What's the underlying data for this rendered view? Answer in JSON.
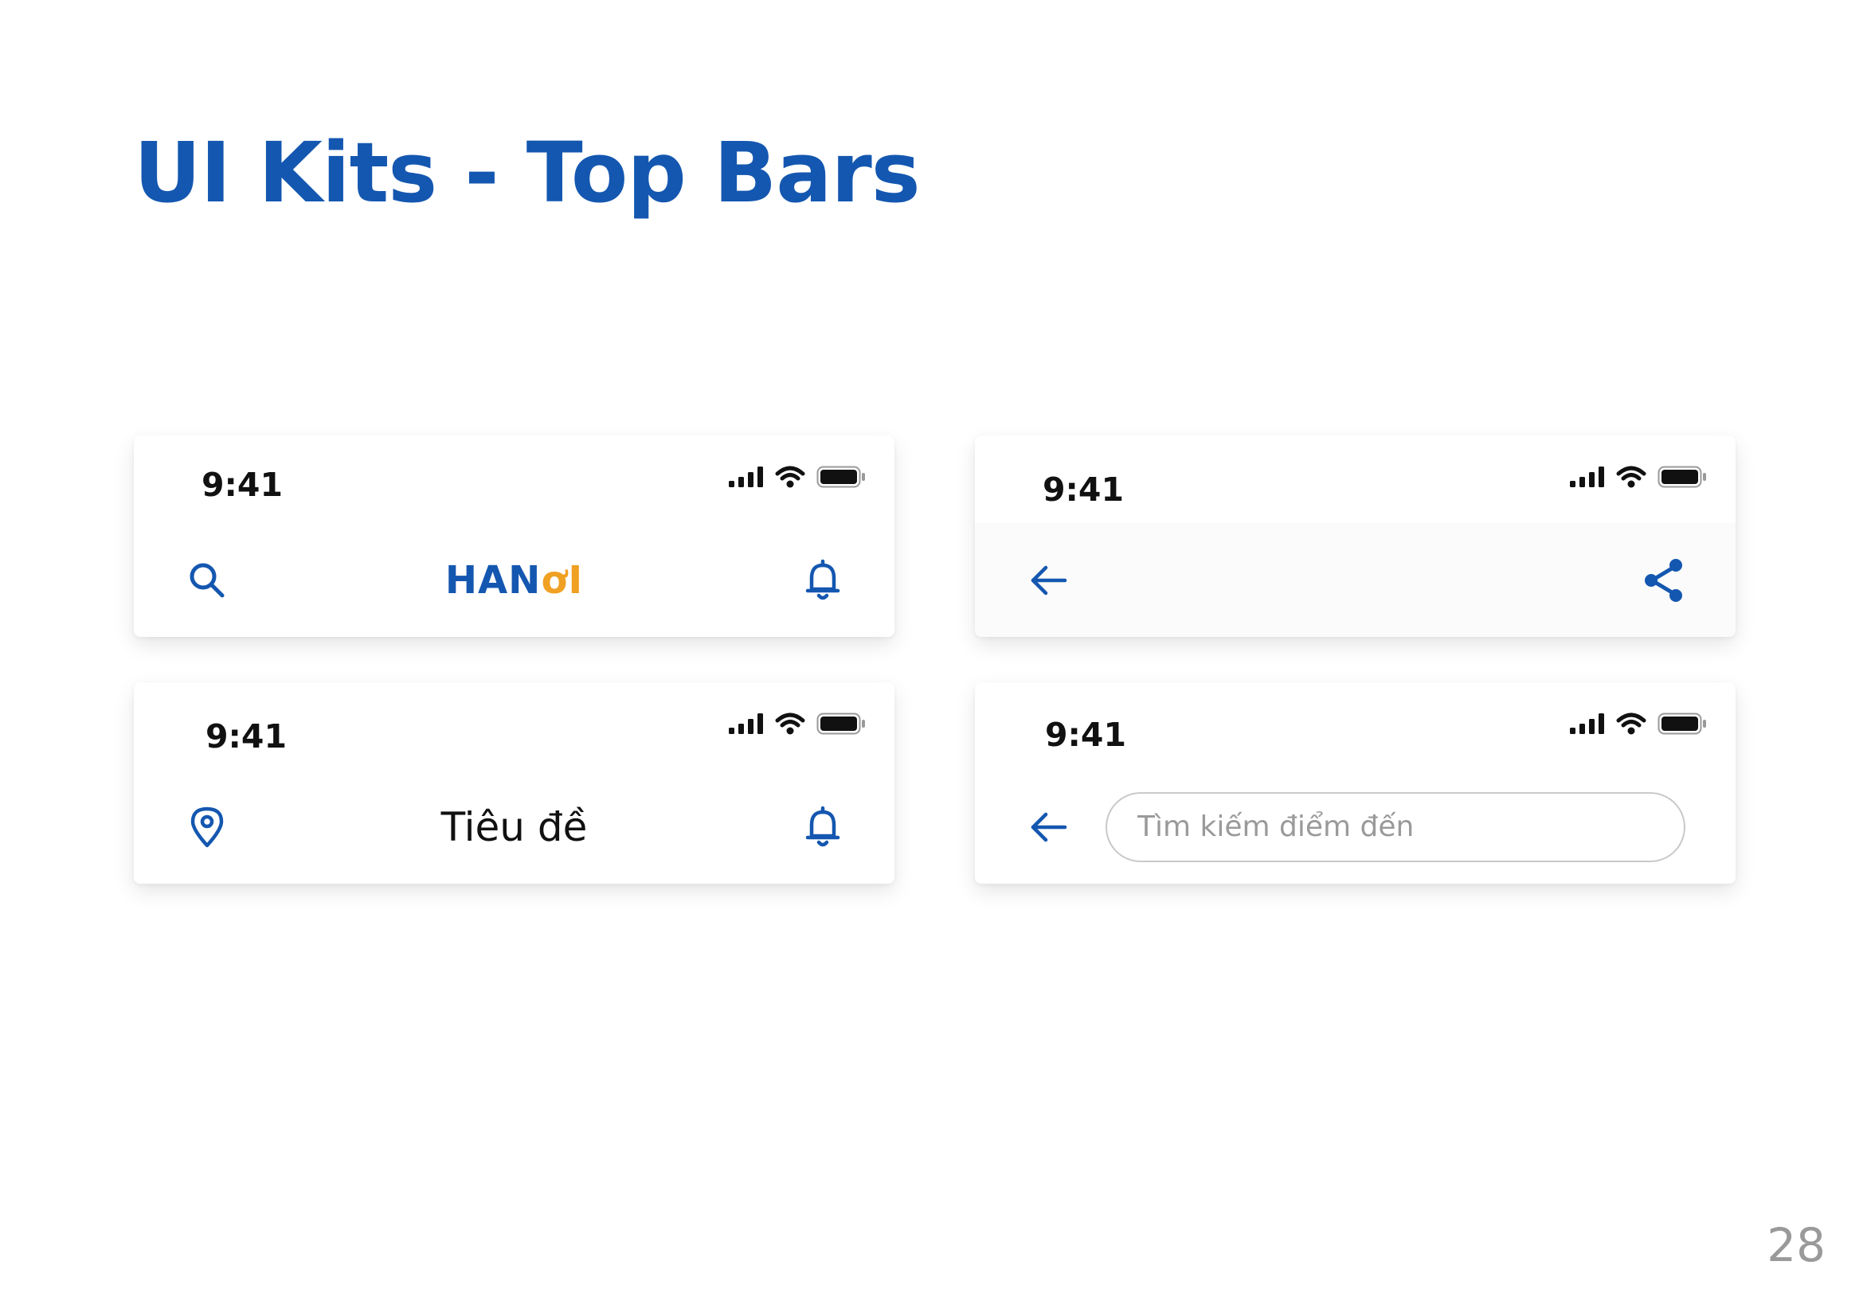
{
  "page": {
    "title": "UI Kits - Top Bars",
    "number": "28"
  },
  "colors": {
    "primary": "#1457b0",
    "accent": "#f0a023",
    "text": "#111111",
    "muted": "#9a9a9a"
  },
  "status_bar": {
    "time": "9:41",
    "icons": [
      "cellular-signal-icon",
      "wifi-icon",
      "battery-icon"
    ]
  },
  "cards": {
    "home": {
      "left_icon": "search-icon",
      "logo": {
        "part1": "HAN",
        "part2": "ơ",
        "part3": "I"
      },
      "right_icon": "bell-icon"
    },
    "detail": {
      "left_icon": "arrow-left-icon",
      "right_icon": "share-icon"
    },
    "title": {
      "left_icon": "location-pin-icon",
      "title": "Tiêu đề",
      "right_icon": "bell-icon"
    },
    "search": {
      "left_icon": "arrow-left-icon",
      "placeholder": "Tìm kiếm điểm đến"
    }
  }
}
